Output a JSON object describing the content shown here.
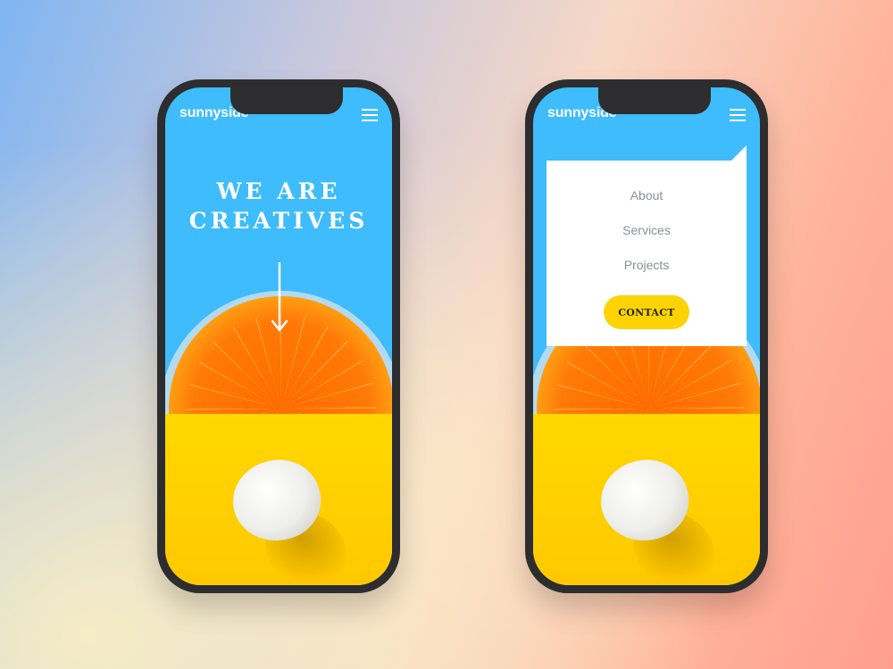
{
  "phones": {
    "left": {
      "logo": "sunnyside",
      "hero_line1": "WE ARE",
      "hero_line2": "CREATIVES"
    },
    "right": {
      "logo": "sunnyside",
      "menu": {
        "items": [
          "About",
          "Services",
          "Projects"
        ],
        "contact_label": "CONTACT"
      }
    }
  },
  "colors": {
    "sky_blue": "#3ebcfc",
    "yellow": "#ffd200",
    "button_yellow": "#fdd301",
    "menu_text": "#8a8e98"
  },
  "icons": {
    "menu": "hamburger-icon",
    "scroll": "arrow-down-icon"
  }
}
